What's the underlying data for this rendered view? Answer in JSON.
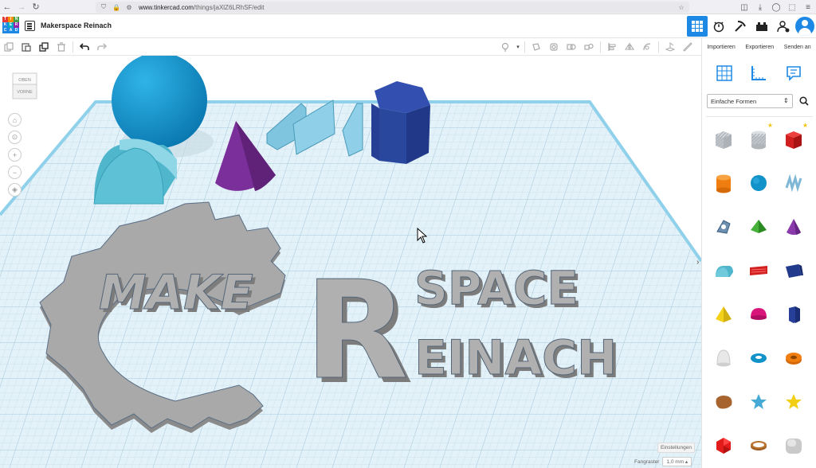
{
  "browser": {
    "url_host": "www.tinkercad.com",
    "url_path": "/things/jaXlZ6LRhSF/edit"
  },
  "header": {
    "logo_letters": [
      "TIN",
      "KER",
      "CAD"
    ],
    "project_title": "Makerspace Reinach"
  },
  "panel": {
    "actions": [
      "Importieren",
      "Exportieren",
      "Senden an"
    ],
    "library_select": "Einfache Formen",
    "shapes": [
      {
        "name": "box-hole",
        "icon": "striped-cube-icon"
      },
      {
        "name": "cylinder-hole",
        "icon": "striped-cylinder-icon",
        "starred": true
      },
      {
        "name": "box",
        "icon": "red-cube-icon",
        "starred": true
      },
      {
        "name": "cylinder",
        "icon": "orange-cylinder-icon"
      },
      {
        "name": "sphere",
        "icon": "blue-sphere-icon"
      },
      {
        "name": "scribble",
        "icon": "scribble-icon"
      },
      {
        "name": "graphic",
        "icon": "graphic-icon"
      },
      {
        "name": "roof",
        "icon": "green-roof-icon"
      },
      {
        "name": "cone",
        "icon": "purple-cone-icon"
      },
      {
        "name": "round-roof",
        "icon": "teal-round-roof-icon"
      },
      {
        "name": "text",
        "icon": "red-text-icon"
      },
      {
        "name": "wedge",
        "icon": "navy-wedge-icon"
      },
      {
        "name": "pyramid",
        "icon": "yellow-pyramid-icon"
      },
      {
        "name": "half-sphere",
        "icon": "magenta-half-sphere-icon"
      },
      {
        "name": "polygon",
        "icon": "navy-polygon-icon"
      },
      {
        "name": "paraboloid",
        "icon": "white-paraboloid-icon"
      },
      {
        "name": "torus",
        "icon": "blue-torus-icon"
      },
      {
        "name": "tube",
        "icon": "orange-tube-icon"
      },
      {
        "name": "star",
        "icon": "blue-star-icon"
      },
      {
        "name": "heart",
        "icon": "yellow-star-icon"
      },
      {
        "name": "icosahedron",
        "icon": "red-polyhedron-icon"
      },
      {
        "name": "ring",
        "icon": "brown-ring-icon"
      },
      {
        "name": "rounded-box",
        "icon": "grey-rounded-cube-icon"
      }
    ]
  },
  "viewcube": {
    "top": "OBEN",
    "front": "VORNE"
  },
  "canvas": {
    "logo_text_left": "MAKE",
    "logo_text_r": "R",
    "logo_text_top_right": "SPACE",
    "logo_text_bottom_right": "EINACH"
  },
  "footer": {
    "settings": "Einstellungen",
    "snap_label": "Fangraster",
    "snap_value": "1,0 mm"
  },
  "colors": {
    "accent": "#1e88e5",
    "grid_bg": "#dfeef6",
    "logo_grey": "#9a9a9a",
    "sphere": "#1192c9",
    "teal": "#5fbfd4",
    "purple": "#7b2f9b",
    "navy": "#2a3f94"
  }
}
